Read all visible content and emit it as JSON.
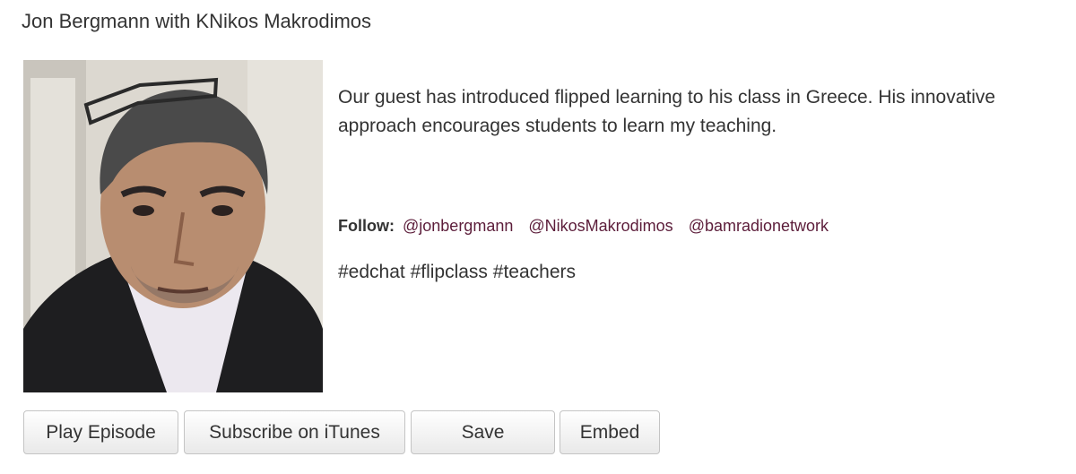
{
  "header": {
    "title": "Jon Bergmann with KNikos Makrodimos"
  },
  "episode": {
    "photo_alt": "guest portrait",
    "description": "Our guest has introduced flipped learning to his class in Greece.  His innovative approach encourages students to learn my teaching.",
    "follow_label": "Follow:",
    "follow_links": [
      "@jonbergmann",
      "@NikosMakrodimos",
      "@bamradionetwork"
    ],
    "hashtags": "#edchat #flipclass #teachers"
  },
  "actions": {
    "play_label": "Play Episode",
    "itunes_label": "Subscribe on iTunes",
    "save_label": "Save",
    "embed_label": "Embed"
  },
  "colors": {
    "link": "#5c1d3a",
    "text": "#333333"
  }
}
